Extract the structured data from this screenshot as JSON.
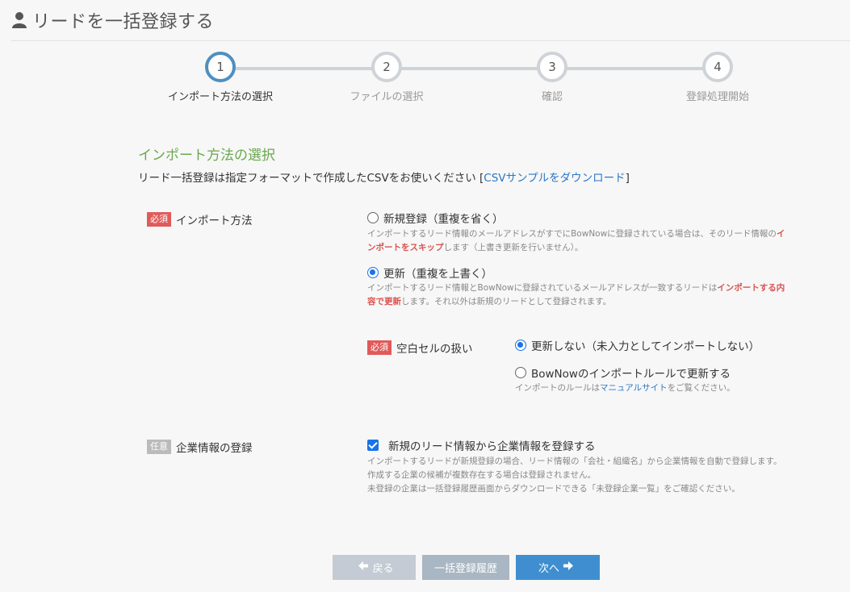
{
  "page": {
    "title": "リードを一括登録する",
    "icon": "user-icon"
  },
  "stepper": {
    "steps": [
      {
        "number": "1",
        "label": "インポート方法の選択",
        "active": true
      },
      {
        "number": "2",
        "label": "ファイルの選択",
        "active": false
      },
      {
        "number": "3",
        "label": "確認",
        "active": false
      },
      {
        "number": "4",
        "label": "登録処理開始",
        "active": false
      }
    ]
  },
  "section": {
    "title": "インポート方法の選択",
    "description_prefix": "リード一括登録は指定フォーマットで作成したCSVをお使いください [",
    "description_link": "CSVサンプルをダウンロード",
    "description_suffix": "]"
  },
  "import_method": {
    "badge": "必須",
    "label": "インポート方法",
    "options": [
      {
        "label": "新規登録（重複を省く）",
        "checked": false,
        "note_before": "インポートするリード情報のメールアドレスがすでにBowNowに登録されている場合は、そのリード情報の",
        "note_emph": "インポートをスキップ",
        "note_after": "します（上書き更新を行いません）。"
      },
      {
        "label": "更新（重複を上書く）",
        "checked": true,
        "note_before": "インポートするリード情報とBowNowに登録されているメールアドレスが一致するリードは",
        "note_emph": "インポートする内容で更新",
        "note_after": "します。それ以外は新規のリードとして登録されます。"
      }
    ]
  },
  "blank_cell": {
    "badge": "必須",
    "label": "空白セルの扱い",
    "options": [
      {
        "label": "更新しない（未入力としてインポートしない）",
        "checked": true
      },
      {
        "label": "BowNowのインポートルールで更新する",
        "checked": false
      }
    ],
    "note_before": "インポートのルールは",
    "note_link": "マニュアルサイト",
    "note_after": "をご覧ください。"
  },
  "company": {
    "badge": "任意",
    "label": "企業情報の登録",
    "checkbox_label": "新規のリード情報から企業情報を登録する",
    "checked": true,
    "notes": [
      "インポートするリードが新規登録の場合、リード情報の「会社・組織名」から企業情報を自動で登録します。",
      "作成する企業の候補が複数存在する場合は登録されません。",
      "未登録の企業は一括登録履歴画面からダウンロードできる「未登録企業一覧」をご確認ください。"
    ]
  },
  "buttons": {
    "back": "戻る",
    "history": "一括登録履歴",
    "next": "次へ"
  },
  "colors": {
    "accent": "#3f8fd0",
    "section_title": "#6aa84f",
    "required_badge": "#e05a5a",
    "optional_badge": "#bbbbbb",
    "active_step": "#4f8fbf"
  }
}
